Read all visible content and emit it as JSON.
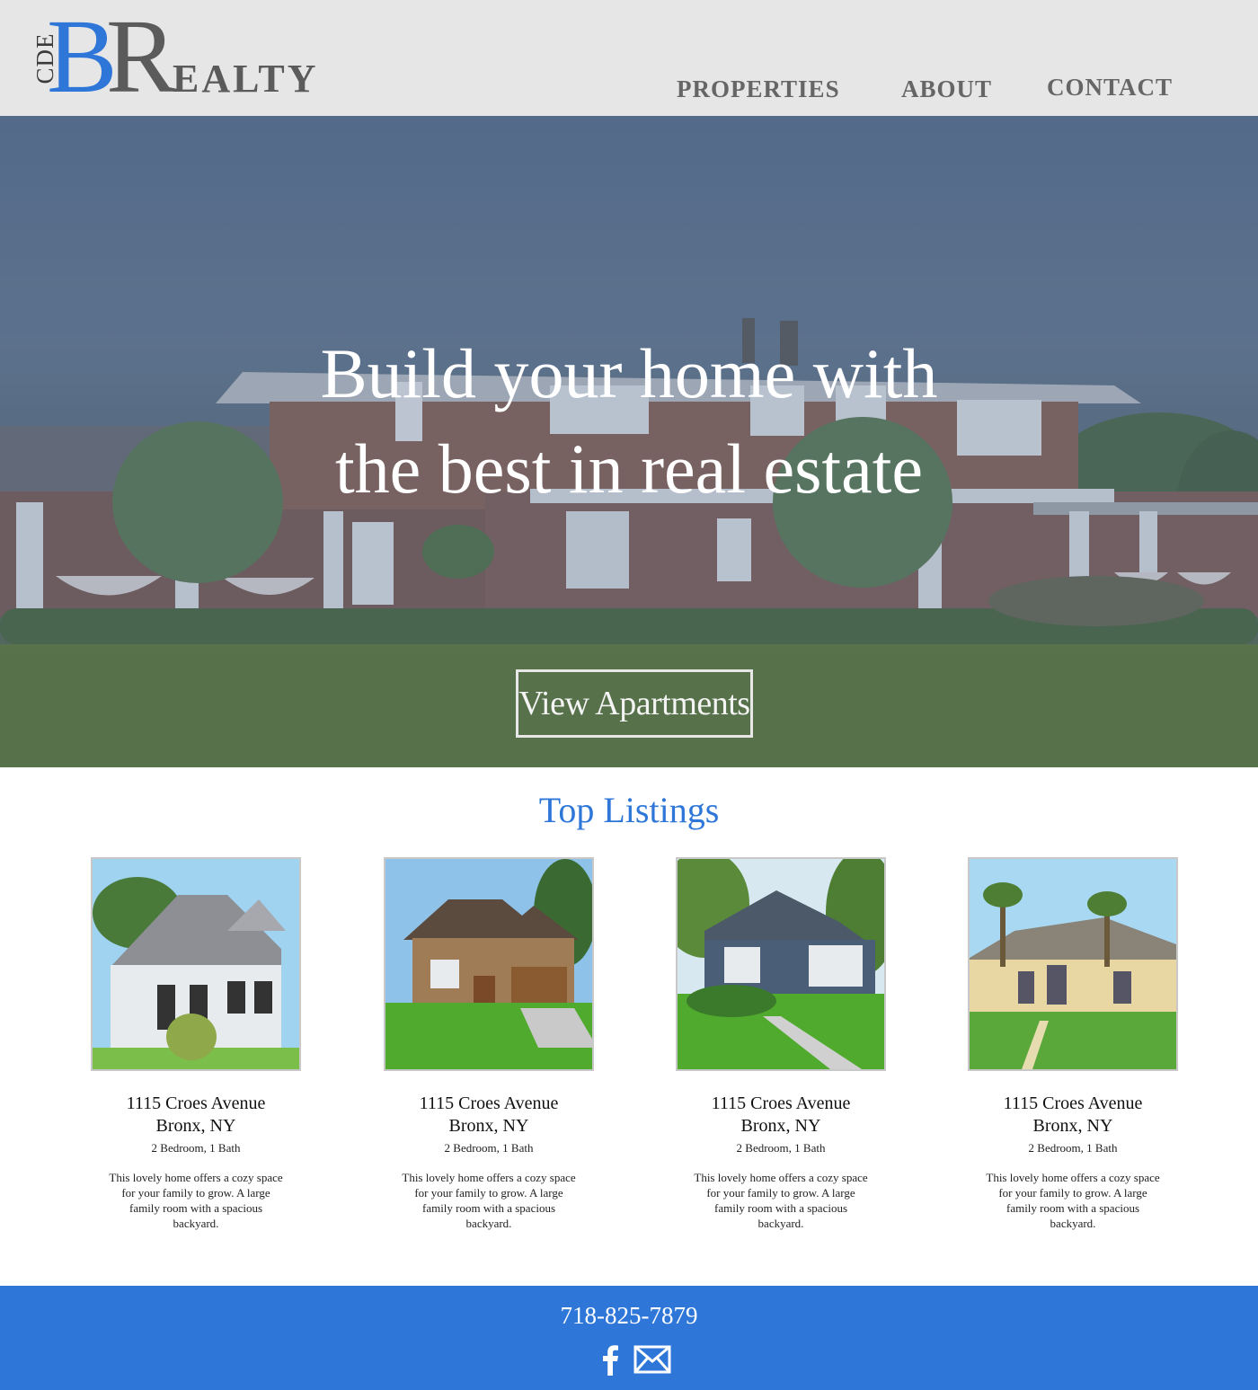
{
  "brand": {
    "logo_cde": "CDE",
    "logo_b": "B",
    "logo_r": "R",
    "logo_ealty": "EALTY",
    "blue": "#2e77d8",
    "gray": "#5b5b5b"
  },
  "nav": {
    "properties": "PROPERTIES",
    "about": "ABOUT",
    "contact": "CONTACT"
  },
  "hero": {
    "title_line1": "Build your home with",
    "title_line2": "the best in real estate",
    "button_label": "View Apartments"
  },
  "listings": {
    "title": "Top Listings",
    "items": [
      {
        "street": "1115 Croes Avenue",
        "city": "Bronx, NY",
        "rooms": "2 Bedroom, 1 Bath",
        "description": "This lovely home offers a cozy space for your family to grow. A large family room with a spacious backyard."
      },
      {
        "street": "1115 Croes Avenue",
        "city": "Bronx, NY",
        "rooms": "2 Bedroom, 1 Bath",
        "description": "This lovely home offers a cozy space for your family to grow. A large family room with a spacious backyard."
      },
      {
        "street": "1115 Croes Avenue",
        "city": "Bronx, NY",
        "rooms": "2 Bedroom, 1 Bath",
        "description": "This lovely home offers a cozy space for your family to grow. A large family room with a spacious backyard."
      },
      {
        "street": "1115 Croes Avenue",
        "city": "Bronx, NY",
        "rooms": "2 Bedroom, 1 Bath",
        "description": "This lovely home offers a cozy space for your family to grow. A large family room with a spacious backyard."
      }
    ]
  },
  "footer": {
    "phone": "718-825-7879",
    "icons": [
      "facebook-icon",
      "mail-icon"
    ]
  }
}
